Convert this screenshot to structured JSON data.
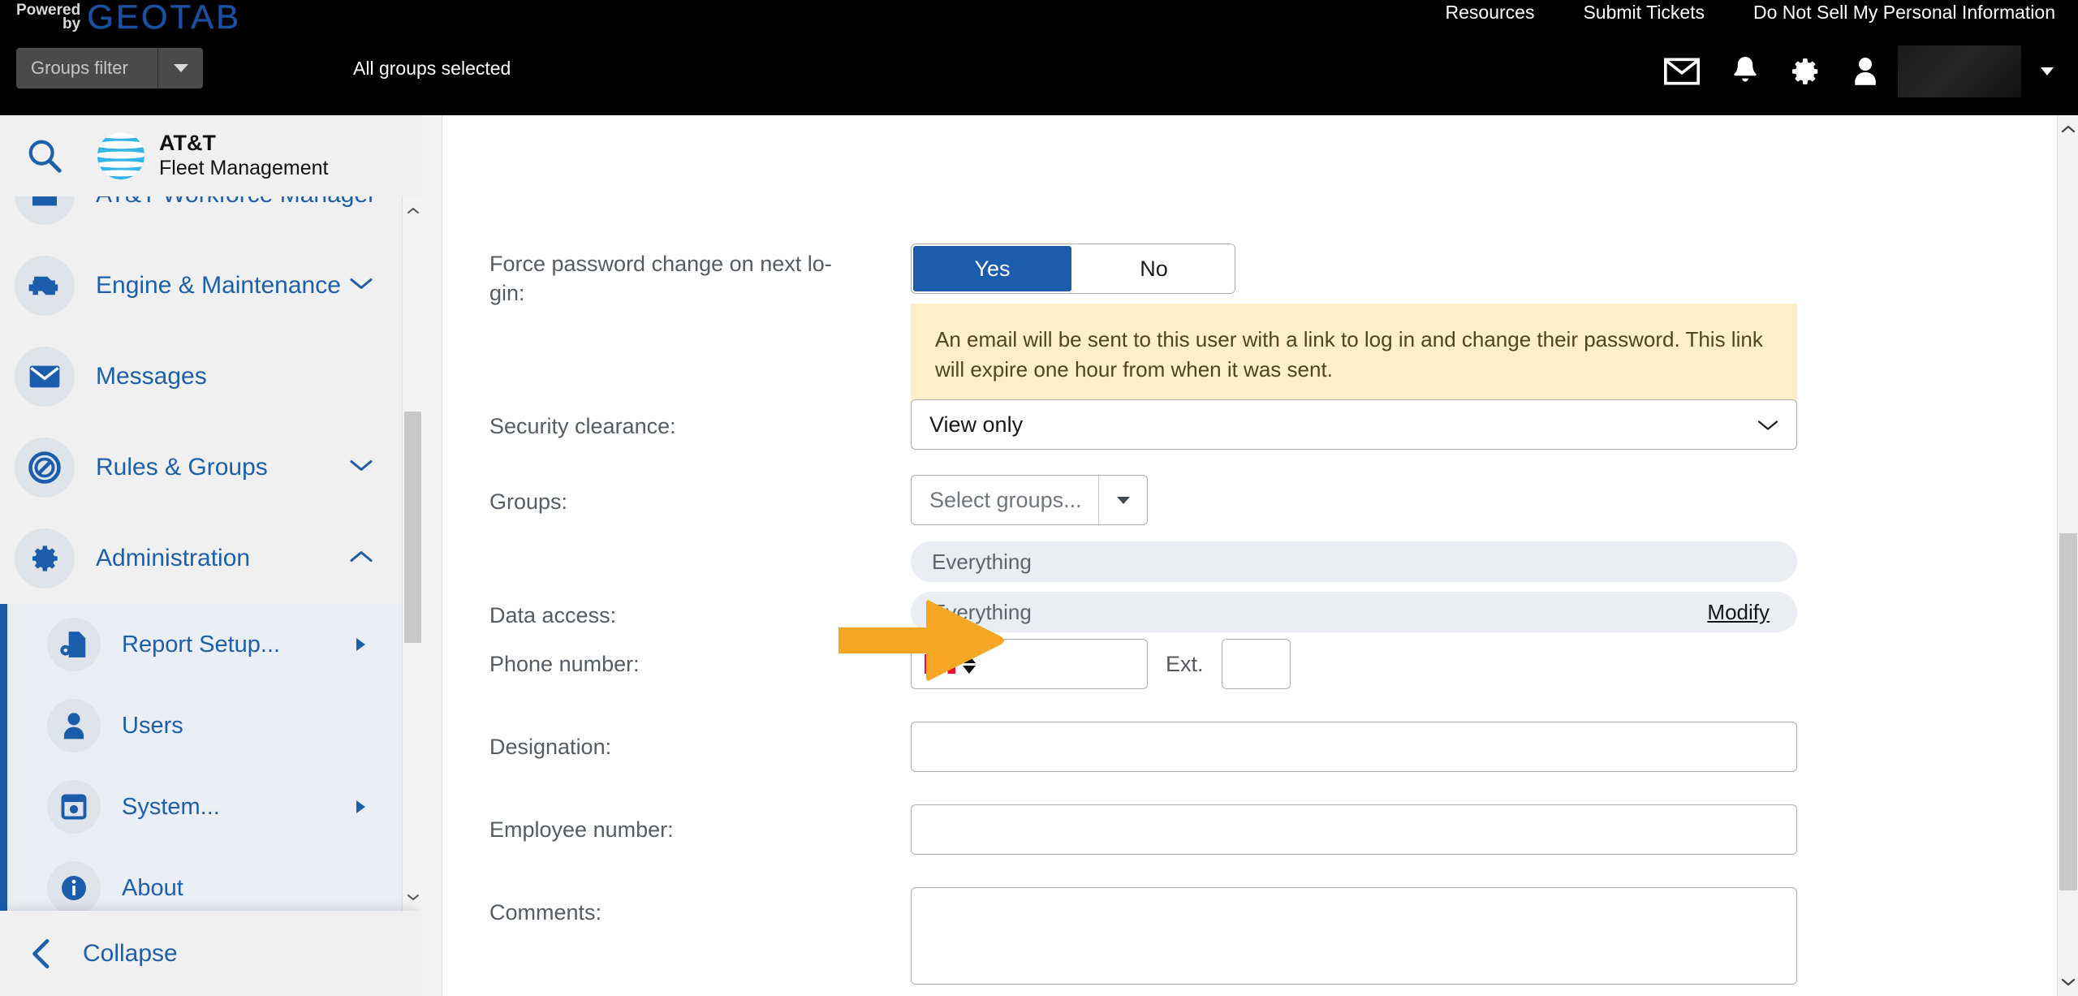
{
  "topbar": {
    "powered_by_line1": "Powered",
    "powered_by_line2": "by",
    "brand": "GEOTAB",
    "groups_filter_placeholder": "Groups filter",
    "all_groups_label": "All groups selected",
    "links": [
      {
        "label": "Resources"
      },
      {
        "label": "Submit Tickets"
      },
      {
        "label": "Do Not Sell My Personal Information"
      }
    ],
    "icons": [
      {
        "name": "mail-icon"
      },
      {
        "name": "bell-icon"
      },
      {
        "name": "gear-icon"
      },
      {
        "name": "user-icon"
      }
    ]
  },
  "sidebar": {
    "search_icon": "search-icon",
    "product_line1": "AT&T",
    "product_line2": "Fleet Management",
    "items": [
      {
        "label": "AT&T Workforce Manager",
        "icon": "workforce-icon",
        "expander": "none"
      },
      {
        "label": "Engine & Maintenance",
        "icon": "engine-icon",
        "expander": "down"
      },
      {
        "label": "Messages",
        "icon": "mail-icon",
        "expander": "none"
      },
      {
        "label": "Rules & Groups",
        "icon": "rules-icon",
        "expander": "down"
      },
      {
        "label": "Administration",
        "icon": "gear-icon",
        "expander": "up"
      }
    ],
    "sub_items": [
      {
        "label": "Report Setup...",
        "icon": "report-setup-icon",
        "has_arrow": true
      },
      {
        "label": "Users",
        "icon": "user-icon",
        "has_arrow": false
      },
      {
        "label": "System...",
        "icon": "system-icon",
        "has_arrow": true
      },
      {
        "label": "About",
        "icon": "info-icon",
        "has_arrow": false
      }
    ],
    "collapse_label": "Collapse",
    "collapse_icon": "chevron-left-icon"
  },
  "form": {
    "force_password": {
      "label": "Force password change on next lo-\ngin:",
      "options": [
        "Yes",
        "No"
      ],
      "selected": "Yes",
      "notice": "An email will be sent to this user with a link to log in and change their password. This link will expire one hour from when it was sent."
    },
    "security_clearance": {
      "label": "Security clearance:",
      "value": "View only"
    },
    "groups": {
      "label": "Groups:",
      "placeholder": "Select groups...",
      "chip": "Everything"
    },
    "data_access": {
      "label": "Data access:",
      "chip": "Everything",
      "modify_label": "Modify",
      "annotation_icon": "orange-arrow-icon",
      "annotation_color": "#F5A623"
    },
    "phone": {
      "label": "Phone number:",
      "country_flag": "canada-flag-icon",
      "value": "",
      "ext_label": "Ext.",
      "ext_value": ""
    },
    "designation": {
      "label": "Designation:",
      "value": ""
    },
    "employee_number": {
      "label": "Employee number:",
      "value": ""
    },
    "comments": {
      "label": "Comments:",
      "value": ""
    }
  },
  "colors": {
    "accent_blue": "#1b5cab",
    "link_blue": "#1d5fa8",
    "notice_bg": "#fdefc7",
    "chip_bg": "#eaeef3",
    "arrow_orange": "#F5A623"
  }
}
